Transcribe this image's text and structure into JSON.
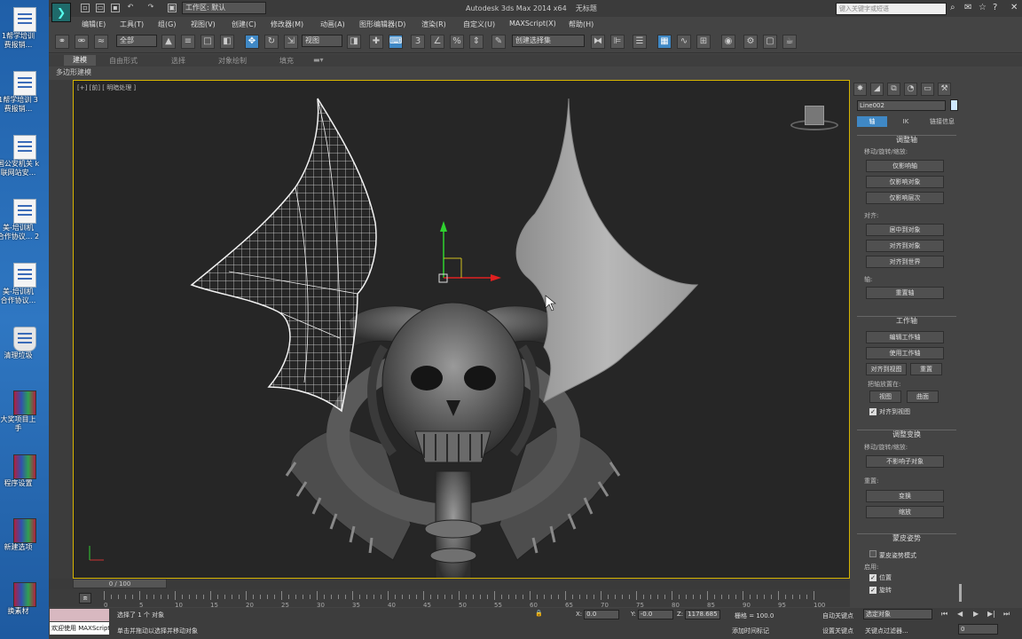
{
  "desktop": {
    "icons": [
      {
        "label": "1帮学培训",
        "label2": "费报销...",
        "type": "doc"
      },
      {
        "label": "1帮学培训 3",
        "label2": "费报销...",
        "type": "doc"
      },
      {
        "label": "国公安机关 k",
        "label2": "联网站安...",
        "type": "doc"
      },
      {
        "label": "美-培训机",
        "label2": "合作协议... 2",
        "type": "doc"
      },
      {
        "label": "美-培训机",
        "label2": "合作协议...",
        "type": "doc"
      },
      {
        "label": "清理垃圾",
        "label2": "",
        "type": "bin"
      },
      {
        "label": "大奖项目上",
        "label2": "手",
        "type": "rar"
      },
      {
        "label": "程序设置",
        "label2": "",
        "type": "rar"
      },
      {
        "label": "新建选项",
        "label2": "",
        "type": "rar"
      },
      {
        "label": "换素材",
        "label2": "",
        "type": "rar"
      }
    ]
  },
  "titlebar": {
    "workspace": "工作区: 默认",
    "title": "Autodesk 3ds Max  2014 x64",
    "subtitle": "无标题",
    "search_placeholder": "键入关键字或短语"
  },
  "menus": [
    "编辑(E)",
    "工具(T)",
    "组(G)",
    "视图(V)",
    "创建(C)",
    "修改器(M)",
    "动画(A)",
    "图形编辑器(D)",
    "渲染(R)",
    "自定义(U)",
    "MAXScript(X)",
    "帮助(H)"
  ],
  "toolbar": {
    "filter": "全部",
    "refcoord": "视图",
    "selset": "创建选择集"
  },
  "ribbon": {
    "tabs": [
      "建模",
      "自由形式",
      "选择",
      "对象绘制",
      "填充"
    ],
    "active": "建模",
    "sub": "多边形建模"
  },
  "viewport": {
    "label": "[+] [前] [ 明暗处理 ]"
  },
  "panel": {
    "object_name": "Line002",
    "subtabs": [
      "轴",
      "IK",
      "链接信息"
    ],
    "active_subtab": "轴",
    "adjust_pivot": "调整轴",
    "move_rotate_scale": "移动/旋转/缩放:",
    "affect_pivot": "仅影响轴",
    "affect_object": "仅影响对象",
    "affect_hierarchy": "仅影响层次",
    "alignment": "对齐:",
    "center_to_object": "居中到对象",
    "align_to_object": "对齐到对象",
    "align_to_world": "对齐到世界",
    "pivot_group": "轴:",
    "reset_pivot": "重置轴",
    "working_pivot": "工作轴",
    "edit_working_pivot": "编辑工作轴",
    "use_working_pivot": "使用工作轴",
    "align_to_view": "对齐到视图",
    "reset": "重置",
    "place_pivot_to": "把轴放置在:",
    "view": "视图",
    "surface": "曲面",
    "align_to_view_check": "对齐到视图",
    "adjust_transform": "调整变换",
    "mrs2": "移动/旋转/缩放:",
    "dont_affect_children": "不影响子对象",
    "reset_group": "重置:",
    "transform": "变换",
    "scale": "缩放",
    "skin_pose": "蒙皮姿势",
    "skin_pose_mode": "蒙皮姿势模式",
    "enable": "启用:",
    "position": "位置",
    "rotation": "旋转"
  },
  "timeline": {
    "slider": "0 / 100",
    "ticks": [
      "0",
      "5",
      "10",
      "15",
      "20",
      "25",
      "30",
      "35",
      "40",
      "45",
      "50",
      "55",
      "60",
      "65",
      "70",
      "75",
      "80",
      "85",
      "90",
      "95",
      "100"
    ]
  },
  "status": {
    "maxscript_line1": "",
    "maxscript_line2": "欢迎使用 MAXScript",
    "selection": "选择了 1 个 对象",
    "hint": "单击并拖动以选择并移动对象",
    "x": "0.0",
    "y": "-0.0",
    "z": "1178.685",
    "grid": "栅格 = 100.0",
    "autokey": "自动关键点",
    "keyfilter_sel": "选定对象",
    "setkey": "设置关键点",
    "keyfilters": "关键点过滤器...",
    "add_time_tag": "添加时间标记",
    "frame": "0"
  }
}
